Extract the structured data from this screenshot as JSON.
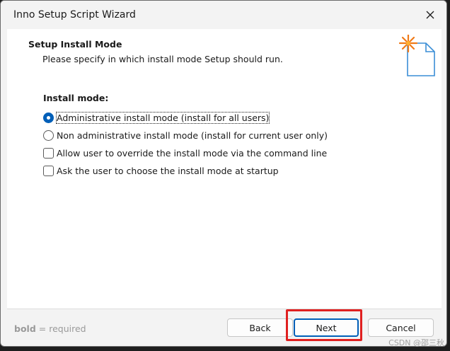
{
  "window": {
    "title": "Inno Setup Script Wizard"
  },
  "header": {
    "title": "Setup Install Mode",
    "subtitle": "Please specify in which install mode Setup should run."
  },
  "content": {
    "section_label": "Install mode:",
    "options": [
      {
        "type": "radio",
        "label": "Administrative install mode (install for all users)",
        "checked": true
      },
      {
        "type": "radio",
        "label": "Non administrative install mode (install for current user only)",
        "checked": false
      },
      {
        "type": "checkbox",
        "label": "Allow user to override the install mode via the command line",
        "checked": false
      },
      {
        "type": "checkbox",
        "label": "Ask the user to choose the install mode at startup",
        "checked": false
      }
    ]
  },
  "footer": {
    "bold_word": "bold",
    "required_text": " = required",
    "back_label": "Back",
    "next_label": "Next",
    "cancel_label": "Cancel"
  },
  "watermark": "CSDN @邵三秋",
  "colors": {
    "accent": "#005fb8",
    "highlight_box": "#e02020"
  }
}
